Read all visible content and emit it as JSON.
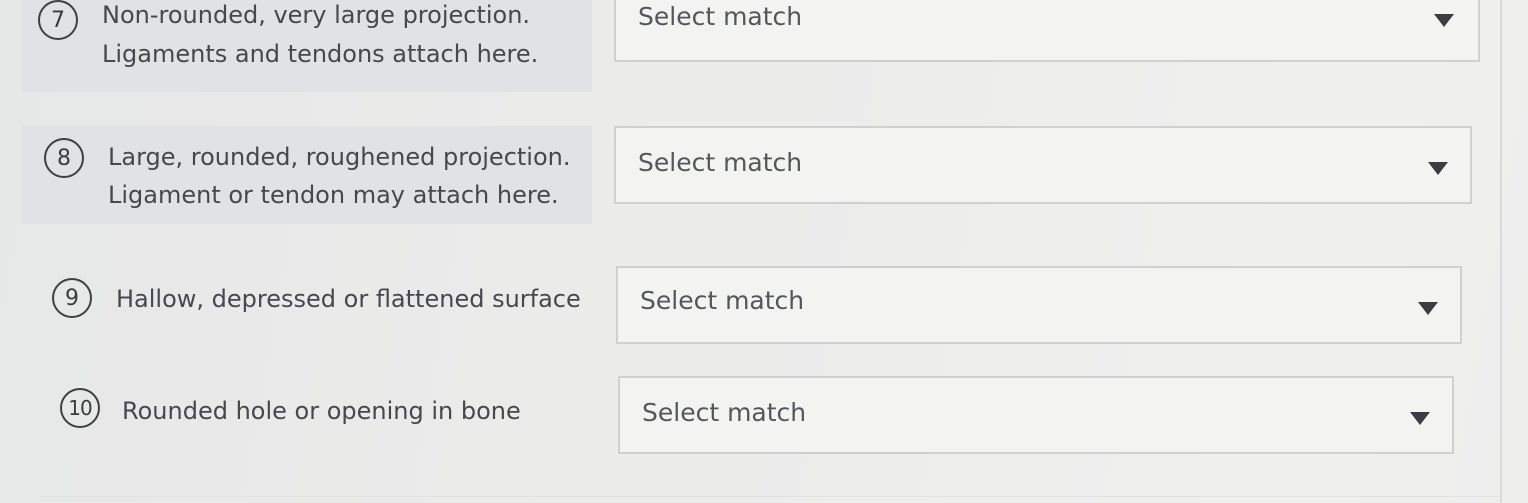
{
  "questions": [
    {
      "number": "7",
      "lines": [
        "Non-rounded, very large projection.",
        "Ligaments and tendons attach here."
      ],
      "select_value": "Select match"
    },
    {
      "number": "8",
      "lines": [
        "Large, rounded, roughened projection.",
        "Ligament or tendon may attach here."
      ],
      "select_value": "Select match"
    },
    {
      "number": "9",
      "lines": [
        "Hallow, depressed or flattened surface"
      ],
      "select_value": "Select match"
    },
    {
      "number": "10",
      "lines": [
        "Rounded hole or opening in bone"
      ],
      "select_value": "Select match"
    }
  ],
  "icons": {
    "dropdown": "caret-down-icon"
  }
}
